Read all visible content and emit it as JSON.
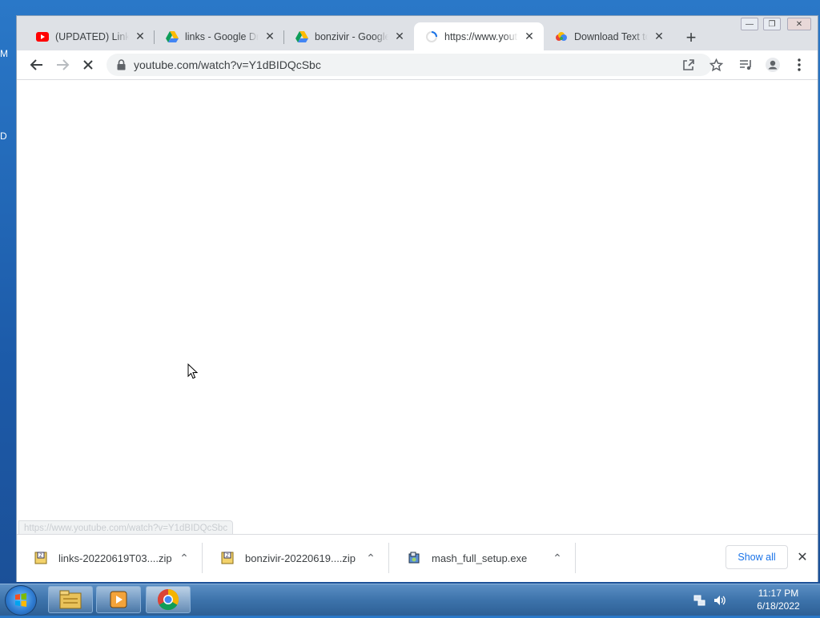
{
  "desktop": {
    "edge_letters": [
      "M",
      "D"
    ]
  },
  "window_controls": {
    "minimize": "—",
    "restore": "❐",
    "close": "✕"
  },
  "tabs": [
    {
      "title": "(UPDATED) LinksKY",
      "icon": "youtube-icon",
      "active": false
    },
    {
      "title": "links - Google Drive",
      "icon": "google-drive-icon",
      "active": false
    },
    {
      "title": "bonzivir - Google Drive",
      "icon": "google-drive-icon",
      "active": false
    },
    {
      "title": "https://www.youtube.com",
      "icon": "loading-spinner-icon",
      "active": true
    },
    {
      "title": "Download Text to",
      "icon": "colorful-app-icon",
      "active": false
    }
  ],
  "new_tab_label": "+",
  "address_bar": {
    "url": "youtube.com/watch?v=Y1dBIDQcSbc"
  },
  "status_url": "https://www.youtube.com/watch?v=Y1dBIDQcSbc",
  "downloads": {
    "items": [
      {
        "name": "links-20220619T03....zip",
        "icon": "zip-file-icon"
      },
      {
        "name": "bonzivir-20220619....zip",
        "icon": "zip-file-icon"
      },
      {
        "name": "mash_full_setup.exe",
        "icon": "installer-file-icon"
      }
    ],
    "show_all_label": "Show all",
    "close_label": "✕"
  },
  "taskbar": {
    "pinned": [
      "file-explorer-icon",
      "media-player-icon",
      "chrome-icon"
    ],
    "clock_time": "11:17 PM",
    "clock_date": "6/18/2022"
  },
  "colors": {
    "accent": "#1a73e8",
    "tabstrip": "#dee1e6",
    "taskbar": "#3d73ab"
  }
}
